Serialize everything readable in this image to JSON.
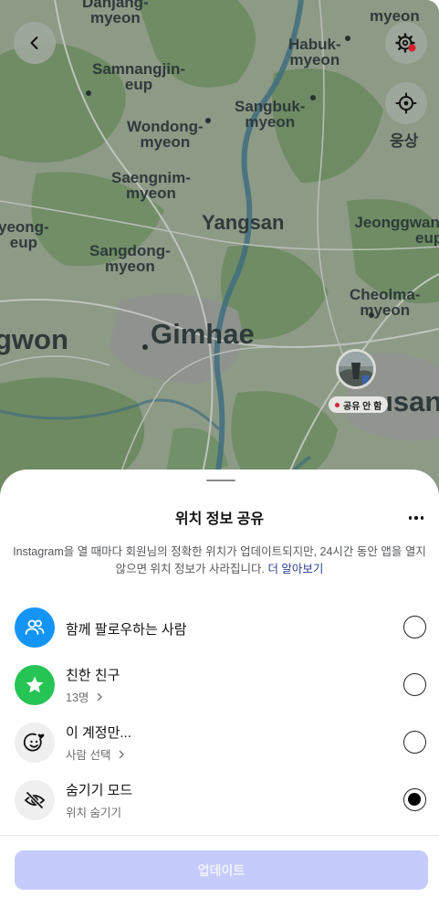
{
  "map": {
    "labels": [
      {
        "id": "danjang",
        "text": "Danjang-\nmyeon"
      },
      {
        "id": "myeon-top",
        "text": "myeon"
      },
      {
        "id": "samnangjin",
        "text": "Samnangjin-\neup"
      },
      {
        "id": "habuk",
        "text": "Habuk-\nmyeon"
      },
      {
        "id": "wondong",
        "text": "Wondong-\nmyeon"
      },
      {
        "id": "sangbuk",
        "text": "Sangbuk-\nmyeon"
      },
      {
        "id": "ungsang",
        "text": "웅상"
      },
      {
        "id": "saengnim",
        "text": "Saengnim-\nmyeon"
      },
      {
        "id": "yangsan",
        "text": "Yangsan"
      },
      {
        "id": "jeonggwan",
        "text": "Jeonggwan\neup"
      },
      {
        "id": "hyeong",
        "text": "hyeong-\neup"
      },
      {
        "id": "sangdong",
        "text": "Sangdong-\nmyeon"
      },
      {
        "id": "cheolma",
        "text": "Cheolma-\nmyeon"
      },
      {
        "id": "gwon",
        "text": "gwon"
      },
      {
        "id": "gimhae",
        "text": "Gimhae"
      },
      {
        "id": "busan",
        "text": "usan"
      }
    ],
    "share_status": "공유 안 함",
    "back_icon": "chevron-left-icon",
    "settings_icon": "gear-icon",
    "locate_icon": "crosshair-icon"
  },
  "sheet": {
    "title": "위치 정보 공유",
    "description": "Instagram을 열 때마다 회원님의 정확한 위치가 업데이트되지만, 24시간 동안 앱을 열지 않으면 위치 정보가 사라집니다.",
    "learn_more": "더 알아보기",
    "options": [
      {
        "title": "함께 팔로우하는 사람",
        "subtitle": "",
        "icon": "people-icon",
        "color": "#1495f5",
        "selected": false
      },
      {
        "title": "친한 친구",
        "subtitle": "13명",
        "icon": "star-icon",
        "color": "#26c454",
        "selected": false
      },
      {
        "title": "이 계정만...",
        "subtitle": "사람 선택",
        "icon": "smiley-heart-icon",
        "color": "#efefef",
        "selected": false
      },
      {
        "title": "숨기기 모드",
        "subtitle": "위치 숨기기",
        "icon": "eye-off-icon",
        "color": "#efefef",
        "selected": true
      }
    ],
    "update_button": "업데이트"
  }
}
